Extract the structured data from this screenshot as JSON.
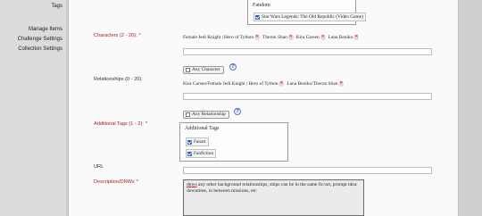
{
  "sidebar": {
    "items": [
      {
        "label": "Tags"
      },
      {
        "label": "Manage Items"
      },
      {
        "label": "Challenge Settings"
      },
      {
        "label": "Collection Settings"
      }
    ]
  },
  "fandom": {
    "title": "Fandom",
    "options": [
      {
        "label": "Star Wars Legends: The Old Republic (Video Game)",
        "checked": true
      }
    ]
  },
  "characters": {
    "label": "Characters (2 - 20):",
    "required_mark": "*",
    "tags": [
      "Female Jedi Knight | Hero of Tython",
      "Theron Shan",
      "Kira Carsen",
      "Lana Beniko"
    ],
    "input_value": ""
  },
  "relationships": {
    "label": "Relationships (0 - 20):",
    "any_button": "Any Character",
    "help": "?",
    "tags": [
      "Kira Carsen/Female Jedi Knight | Hero of Tython",
      "Lana Beniko/Theron Shan"
    ],
    "input_value": ""
  },
  "additional_tags": {
    "label": "Additional Tags (1 - 2):",
    "required_mark": "*",
    "any_button": "Any Relationship",
    "help": "?",
    "panel_title": "Additional Tags",
    "options": [
      {
        "label": "Fanart",
        "checked": true
      },
      {
        "label": "Fanfiction",
        "checked": true
      }
    ],
    "input_value": ""
  },
  "url": {
    "label": "URL",
    "input_value": ""
  },
  "description": {
    "label": "Description/DNWs",
    "required_mark": "*",
    "value_first": "dnws",
    "value_rest": " any other background relationships, ships can be in the same fic/art, prompt idea: downtime, in between missions, etc"
  },
  "colors": {
    "required_label": "#b31b1b",
    "checkbox": "#1f5fb8",
    "remove_x": "#b01616"
  }
}
